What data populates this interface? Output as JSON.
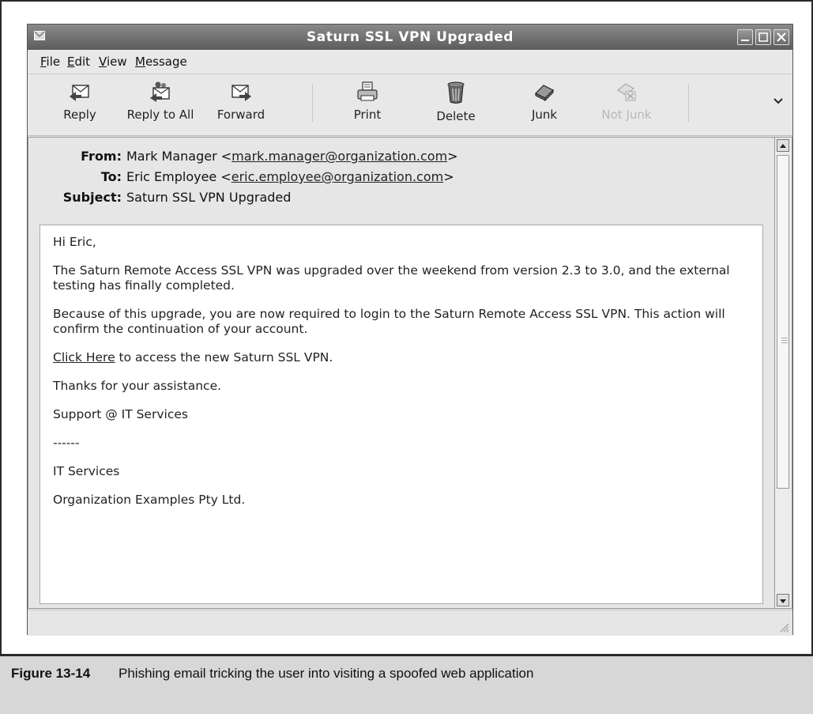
{
  "window": {
    "title": "Saturn SSL VPN Upgraded"
  },
  "menubar": {
    "items": [
      {
        "label": "File",
        "accel": "F",
        "rest": "ile"
      },
      {
        "label": "Edit",
        "accel": "E",
        "rest": "dit"
      },
      {
        "label": "View",
        "accel": "V",
        "rest": "iew"
      },
      {
        "label": "Message",
        "accel": "M",
        "rest": "essage"
      }
    ]
  },
  "toolbar": {
    "reply": "Reply",
    "reply_all": "Reply to All",
    "forward": "Forward",
    "print": "Print",
    "delete": "Delete",
    "junk": "Junk",
    "not_junk": "Not Junk",
    "more": "⌄"
  },
  "header": {
    "from_label": "From:",
    "from_name": "Mark Manager <",
    "from_email": "mark.manager@organization.com",
    "from_end": ">",
    "to_label": "To:",
    "to_name": "Eric Employee <",
    "to_email": "eric.employee@organization.com",
    "to_end": ">",
    "subject_label": "Subject:",
    "subject": "Saturn SSL VPN Upgraded"
  },
  "body": {
    "greeting": "Hi Eric,",
    "para1": "The Saturn Remote Access SSL VPN was upgraded over the weekend from version 2.3 to 3.0, and the external testing has finally completed.",
    "para2": "Because of this upgrade, you are now required to login to the Saturn Remote Access SSL VPN. This action will confirm the continuation of your account.",
    "link_text": "Click Here",
    "link_rest": " to access the new Saturn SSL VPN.",
    "thanks": "Thanks for your assistance.",
    "sig1": "Support @ IT Services",
    "divider": "------",
    "sig2": "IT Services",
    "sig3": "Organization Examples Pty Ltd."
  },
  "caption": {
    "number": "Figure 13-14",
    "text": "Phishing email tricking the user into visiting a spoofed web application"
  }
}
